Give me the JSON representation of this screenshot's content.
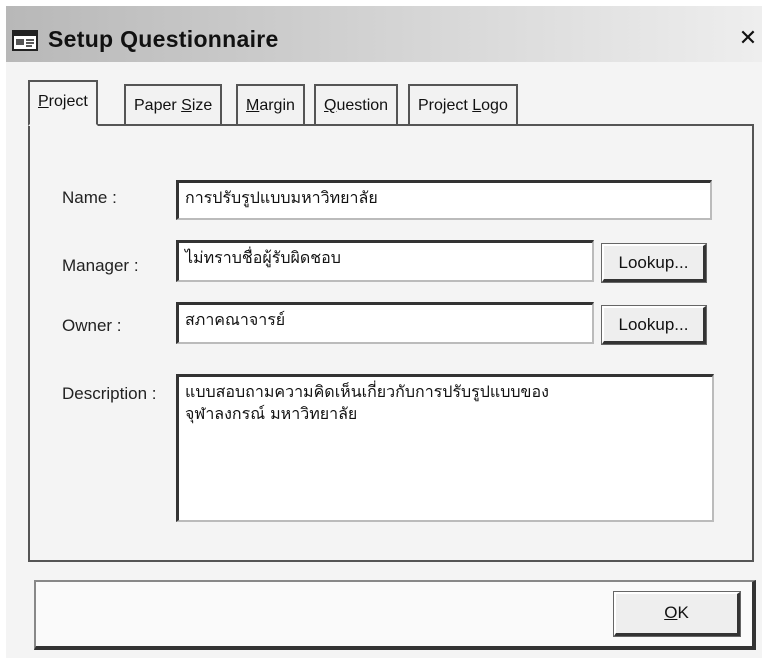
{
  "window": {
    "title": "Setup Questionnaire",
    "close_glyph": "✕"
  },
  "tabs": [
    {
      "label": "Project",
      "accel": "P",
      "rest": "roject",
      "pre": "",
      "active": true
    },
    {
      "label": "Paper Size",
      "pre": "Paper ",
      "accel": "S",
      "rest": "ize",
      "active": false
    },
    {
      "label": "Margin",
      "pre": "",
      "accel": "M",
      "rest": "argin",
      "active": false
    },
    {
      "label": "Question",
      "pre": "",
      "accel": "Q",
      "rest": "uestion",
      "active": false
    },
    {
      "label": "Project Logo",
      "pre": "Project ",
      "accel": "L",
      "rest": "ogo",
      "active": false
    }
  ],
  "form": {
    "name_label": "Name :",
    "name_value": "การปรับรูปแบบมหาวิทยาลัย",
    "manager_label": "Manager :",
    "manager_value": "ไม่ทราบชื่อผู้รับผิดชอบ",
    "owner_label": "Owner :",
    "owner_value": "สภาคณาจารย์",
    "description_label": "Description :",
    "description_value": "แบบสอบถามความคิดเห็นเกี่ยวกับการปรับรูปแบบของ\nจุฬาลงกรณ์ มหาวิทยาลัย",
    "lookup_label": "Lookup..."
  },
  "footer": {
    "ok_accel": "O",
    "ok_rest": "K"
  },
  "icons": {
    "title_icon": "window-app-icon"
  }
}
